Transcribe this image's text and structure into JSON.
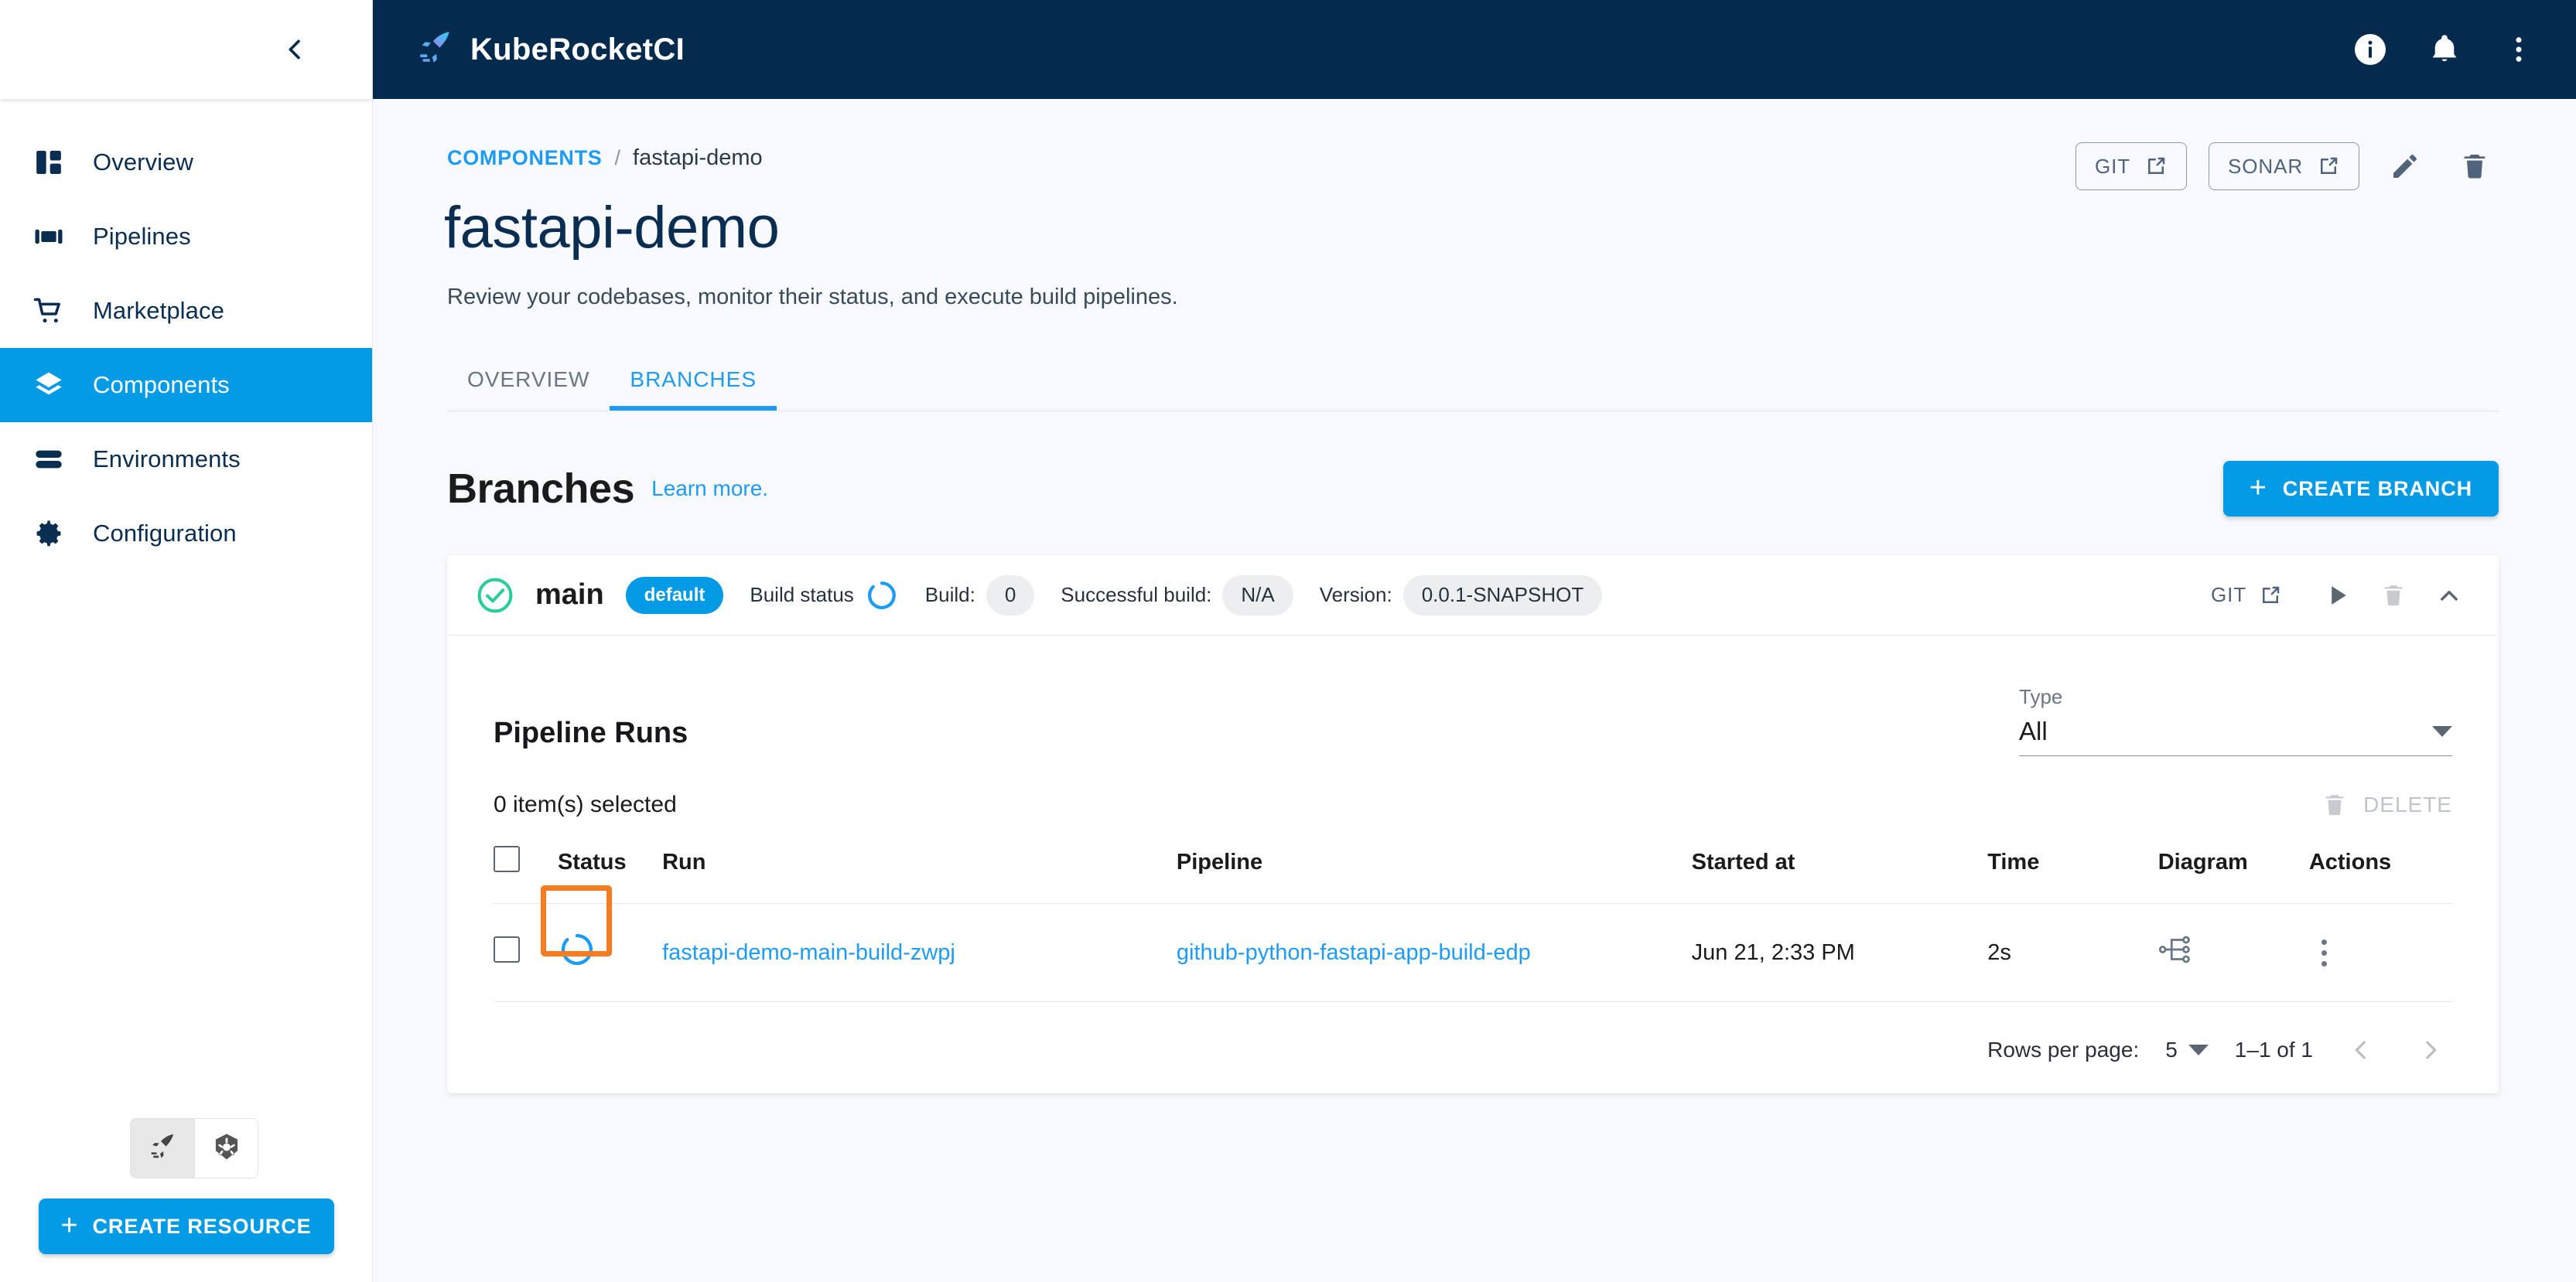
{
  "sidebar": {
    "collapse_icon": "chevron-left-icon",
    "items": [
      {
        "label": "Overview",
        "icon": "dashboard-icon",
        "active": false
      },
      {
        "label": "Pipelines",
        "icon": "pipelines-icon",
        "active": false
      },
      {
        "label": "Marketplace",
        "icon": "cart-icon",
        "active": false
      },
      {
        "label": "Components",
        "icon": "layers-icon",
        "active": true
      },
      {
        "label": "Environments",
        "icon": "environments-icon",
        "active": false
      },
      {
        "label": "Configuration",
        "icon": "gear-icon",
        "active": false
      }
    ],
    "cluster_toggle": [
      {
        "icon": "kuberocket-logo-icon",
        "selected": true
      },
      {
        "icon": "kubernetes-icon",
        "selected": false
      }
    ],
    "create_resource_label": "CREATE RESOURCE",
    "create_resource_plus": "+"
  },
  "topbar": {
    "brand": "KubeRocketCI",
    "logo_icon": "kuberocket-rocket-icon",
    "icons": [
      {
        "name": "info-icon"
      },
      {
        "name": "bell-icon"
      },
      {
        "name": "kebab-menu-icon"
      }
    ]
  },
  "breadcrumb": {
    "root": "COMPONENTS",
    "separator": "/",
    "current": "fastapi-demo"
  },
  "page": {
    "title": "fastapi-demo",
    "subtitle": "Review your codebases, monitor their status, and execute build pipelines."
  },
  "head_actions": {
    "git_label": "GIT",
    "sonar_label": "SONAR",
    "edit_icon": "pencil-icon",
    "delete_icon": "trash-icon"
  },
  "tabs": [
    {
      "label": "OVERVIEW",
      "active": false
    },
    {
      "label": "BRANCHES",
      "active": true
    }
  ],
  "branches_section": {
    "title": "Branches",
    "learn_more": "Learn more.",
    "create_branch_label": "CREATE BRANCH",
    "create_branch_plus": "+"
  },
  "branch": {
    "status_icon": "check-circle-icon",
    "name": "main",
    "default_chip": "default",
    "build_status_label": "Build status",
    "build_status_icon": "spinner-icon",
    "build_label": "Build:",
    "build_value": "0",
    "successful_build_label": "Successful build:",
    "successful_build_value": "N/A",
    "version_label": "Version:",
    "version_value": "0.0.1-SNAPSHOT",
    "git_label": "GIT",
    "run_icon": "play-icon",
    "delete_icon": "trash-icon",
    "collapse_icon": "chevron-up-icon"
  },
  "runs": {
    "title": "Pipeline Runs",
    "type_filter": {
      "label": "Type",
      "value": "All",
      "options": [
        "All"
      ]
    },
    "selected_text": "0 item(s) selected",
    "delete_label": "DELETE",
    "delete_icon": "trash-icon",
    "columns": [
      "",
      "Status",
      "Run",
      "Pipeline",
      "Started at",
      "Time",
      "Diagram",
      "Actions"
    ],
    "rows": [
      {
        "checked": false,
        "status_icon": "spinner-icon",
        "status_highlighted": true,
        "run": "fastapi-demo-main-build-zwpj",
        "pipeline": "github-python-fastapi-app-build-edp",
        "started_at": "Jun 21, 2:33 PM",
        "time": "2s",
        "diagram_icon": "diagram-icon",
        "actions_icon": "kebab-menu-icon"
      }
    ],
    "pagination": {
      "rows_per_page_label": "Rows per page:",
      "rows_per_page_value": "5",
      "range": "1–1 of 1",
      "prev_icon": "chevron-left-icon",
      "next_icon": "chevron-right-icon"
    }
  },
  "colors": {
    "accent": "#039be5",
    "link": "#1d9bf5",
    "navy": "#042b4d",
    "success": "#2ecc9b",
    "highlight": "#f57c20",
    "page_bg": "#f7f9fc"
  }
}
